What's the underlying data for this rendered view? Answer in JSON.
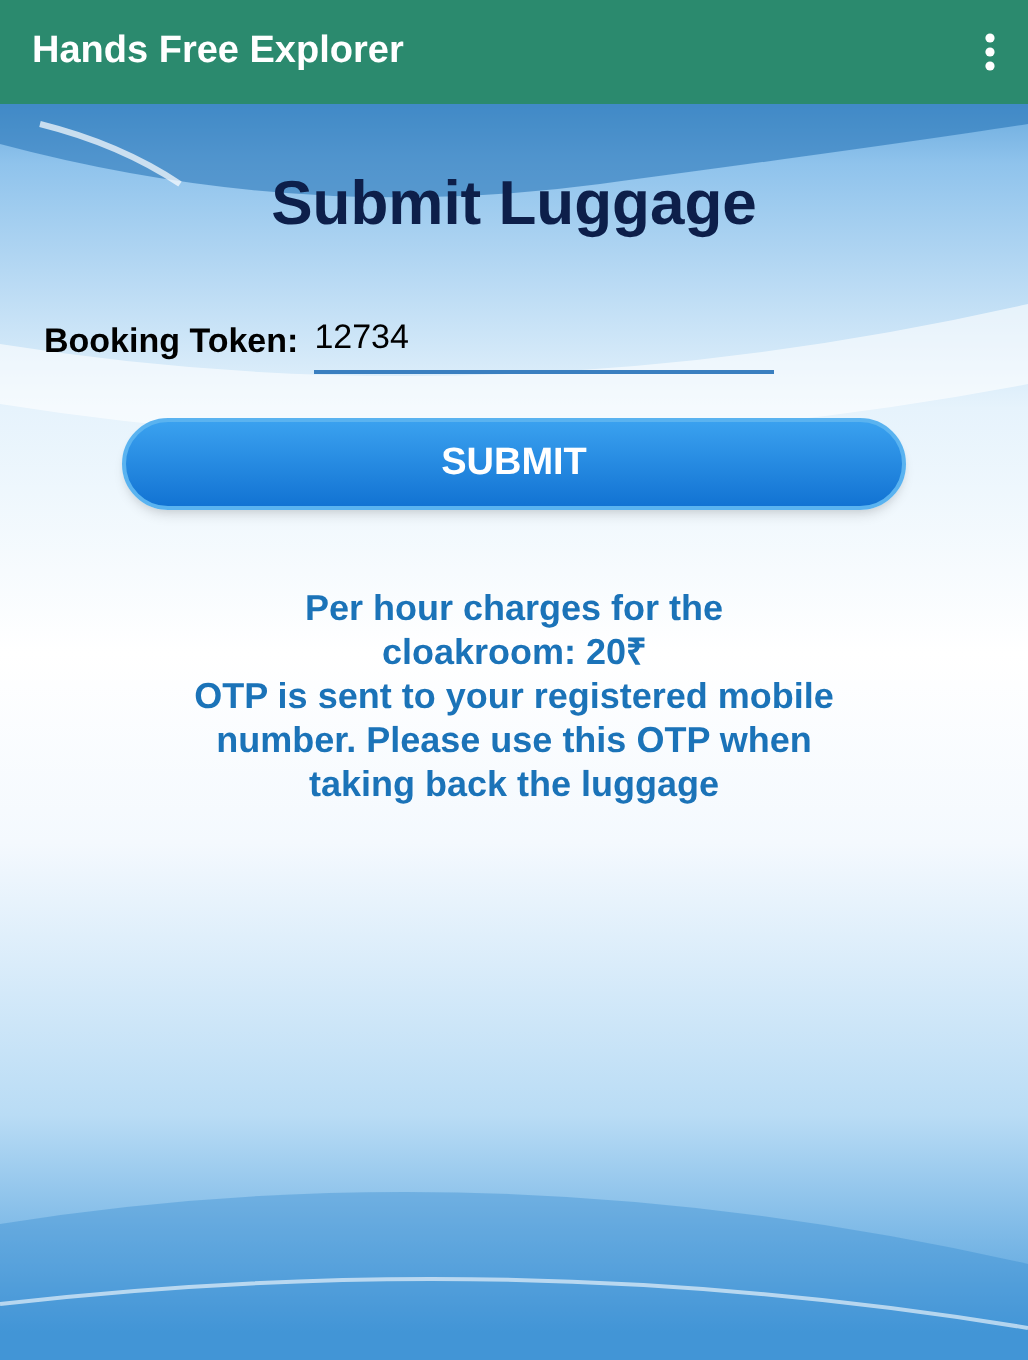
{
  "app_bar": {
    "title": "Hands Free Explorer"
  },
  "heading": "Submit Luggage",
  "booking_field": {
    "label": "Booking Token:",
    "value": "12734"
  },
  "submit_button": {
    "label": "SUBMIT"
  },
  "info_lines": [
    "Per hour charges for the cloakroom: 20₹",
    "OTP is sent to your registered mobile number. Please use this OTP when taking back the luggage"
  ]
}
